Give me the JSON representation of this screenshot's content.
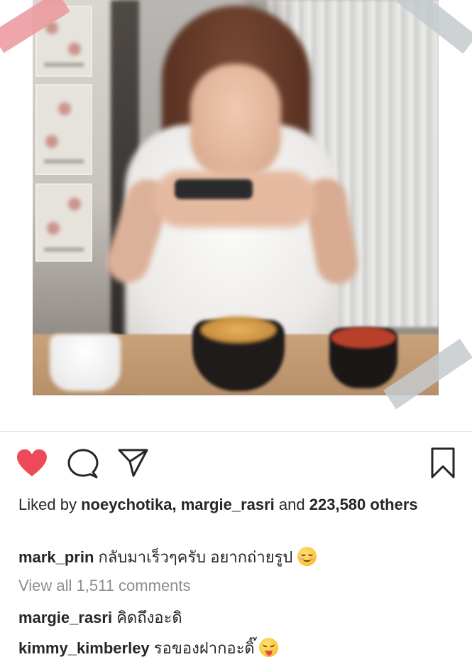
{
  "post": {
    "photo": {
      "description_icon": "photo-of-woman-with-camera"
    },
    "actions": {
      "like_icon": "heart-filled-icon",
      "comment_icon": "comment-bubble-icon",
      "share_icon": "paper-plane-icon",
      "save_icon": "bookmark-icon",
      "like_color": "#ed4956"
    },
    "likes": {
      "prefix": "Liked by",
      "user1": "noeychotika,",
      "user2": "margie_rasri",
      "and_text": "and",
      "count": "223,580",
      "others": "others"
    },
    "caption": {
      "username": "mark_prin",
      "text": "กลับมาเร็วๆครับ อยากถ่ายรูป",
      "emoji": "relieved-face-emoji"
    },
    "view_all_comments": "View all 1,511 comments",
    "comments": [
      {
        "username": "margie_rasri",
        "text": "คิดถึงอะดิ"
      },
      {
        "username": "kimmy_kimberley",
        "text": "รอของฝากอะดิ๊",
        "emoji": "tongue-out-wink-emoji"
      }
    ]
  }
}
